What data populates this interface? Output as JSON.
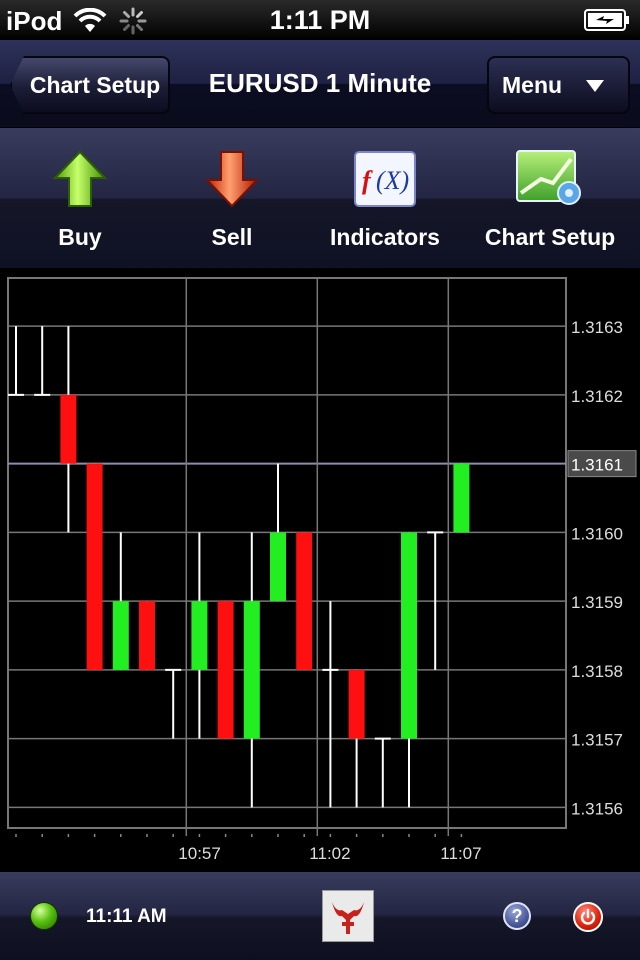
{
  "status_bar": {
    "carrier": "iPod",
    "time": "1:11 PM",
    "icons": [
      "wifi-icon",
      "activity-spinner-icon",
      "battery-charging-icon"
    ]
  },
  "nav": {
    "back_label": "Chart Setup",
    "title": "EURUSD 1 Minute",
    "menu_label": "Menu"
  },
  "toolbar": {
    "items": [
      {
        "label": "Buy",
        "icon": "buy-arrow-up-icon",
        "color": "#7ed321"
      },
      {
        "label": "Sell",
        "icon": "sell-arrow-down-icon",
        "color": "#e8380c"
      },
      {
        "label": "Indicators",
        "icon": "function-fx-icon"
      },
      {
        "label": "Chart Setup",
        "icon": "chart-settings-icon"
      }
    ]
  },
  "chart_data": {
    "type": "candlestick",
    "ylim": [
      1.31557,
      1.31637
    ],
    "y_ticks": [
      "1.3163",
      "1.3162",
      "1.3161",
      "1.3160",
      "1.3159",
      "1.3158",
      "1.3157",
      "1.3156"
    ],
    "current_price": "1.3161",
    "x_ticks": [
      {
        "index": 6.5,
        "label": "10:57"
      },
      {
        "index": 11.5,
        "label": "11:02"
      },
      {
        "index": 16.5,
        "label": "11:07"
      }
    ],
    "up_color": "#22ee22",
    "down_color": "#ff1010",
    "candles": [
      {
        "o": 1.3162,
        "h": 1.3163,
        "l": 1.3162,
        "c": 1.3162
      },
      {
        "o": 1.3162,
        "h": 1.3163,
        "l": 1.3162,
        "c": 1.3162
      },
      {
        "o": 1.3162,
        "h": 1.3163,
        "l": 1.316,
        "c": 1.3161
      },
      {
        "o": 1.3161,
        "h": 1.3161,
        "l": 1.3158,
        "c": 1.3158
      },
      {
        "o": 1.3158,
        "h": 1.316,
        "l": 1.3158,
        "c": 1.3159
      },
      {
        "o": 1.3159,
        "h": 1.3159,
        "l": 1.3158,
        "c": 1.3158
      },
      {
        "o": 1.3158,
        "h": 1.3158,
        "l": 1.3157,
        "c": 1.3158
      },
      {
        "o": 1.3158,
        "h": 1.316,
        "l": 1.3157,
        "c": 1.3159
      },
      {
        "o": 1.3159,
        "h": 1.3159,
        "l": 1.3157,
        "c": 1.3157
      },
      {
        "o": 1.3157,
        "h": 1.316,
        "l": 1.3156,
        "c": 1.3159
      },
      {
        "o": 1.3159,
        "h": 1.3161,
        "l": 1.3159,
        "c": 1.316
      },
      {
        "o": 1.316,
        "h": 1.316,
        "l": 1.3158,
        "c": 1.3158
      },
      {
        "o": 1.3158,
        "h": 1.3159,
        "l": 1.3156,
        "c": 1.3158
      },
      {
        "o": 1.3158,
        "h": 1.3158,
        "l": 1.3156,
        "c": 1.3157
      },
      {
        "o": 1.3157,
        "h": 1.3157,
        "l": 1.3156,
        "c": 1.3157
      },
      {
        "o": 1.3157,
        "h": 1.316,
        "l": 1.3156,
        "c": 1.316
      },
      {
        "o": 1.316,
        "h": 1.316,
        "l": 1.3158,
        "c": 1.316
      },
      {
        "o": 1.316,
        "h": 1.3161,
        "l": 1.316,
        "c": 1.3161
      }
    ]
  },
  "bottom_bar": {
    "connection_status": "connected",
    "connection_color": "#58c110",
    "time": "11:11 AM",
    "icons": [
      "connection-status-icon",
      "broker-logo-icon",
      "help-icon",
      "power-icon"
    ]
  }
}
